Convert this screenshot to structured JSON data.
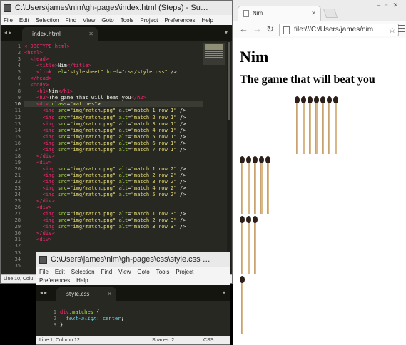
{
  "sublime_main": {
    "title": "C:\\Users\\james\\nim\\gh-pages\\index.html (Steps) - Su…",
    "menu": [
      "File",
      "Edit",
      "Selection",
      "Find",
      "View",
      "Goto",
      "Tools",
      "Project",
      "Preferences",
      "Help"
    ],
    "tab_label": "index.html",
    "current_line": 10,
    "line_numbers": [
      "1",
      "2",
      "3",
      "4",
      "5",
      "6",
      "7",
      "8",
      "9",
      "10",
      "11",
      "12",
      "13",
      "14",
      "15",
      "16",
      "17",
      "18",
      "19",
      "20",
      "21",
      "22",
      "23",
      "24",
      "25",
      "26",
      "27",
      "28",
      "29",
      "30",
      "31",
      "32",
      "33",
      "34",
      "35"
    ],
    "status": "Line 10, Colu"
  },
  "sublime_css": {
    "title": "C:\\Users\\james\\nim\\gh-pages\\css\\style.css …",
    "menu": [
      "File",
      "Edit",
      "Selection",
      "Find",
      "View",
      "Goto",
      "Tools",
      "Project",
      "Preferences",
      "Help"
    ],
    "tab_label": "style.css",
    "line_numbers": [
      "1",
      "2",
      "3"
    ],
    "status_position": "Line 1, Column 12",
    "status_spaces": "Spaces: 2",
    "status_syntax": "CSS"
  },
  "browser": {
    "tab_title": "Nim",
    "url": "file:///C:/Users/james/nim",
    "page_heading": "Nim",
    "page_subheading": "The game that will beat you",
    "match_rows": [
      7,
      5,
      3,
      1
    ],
    "match_alt_prefix": "match"
  },
  "icons": {
    "back": "back-arrow-icon",
    "forward": "forward-arrow-icon",
    "reload": "reload-icon",
    "star": "bookmark-star-icon",
    "menu": "hamburger-menu-icon"
  }
}
